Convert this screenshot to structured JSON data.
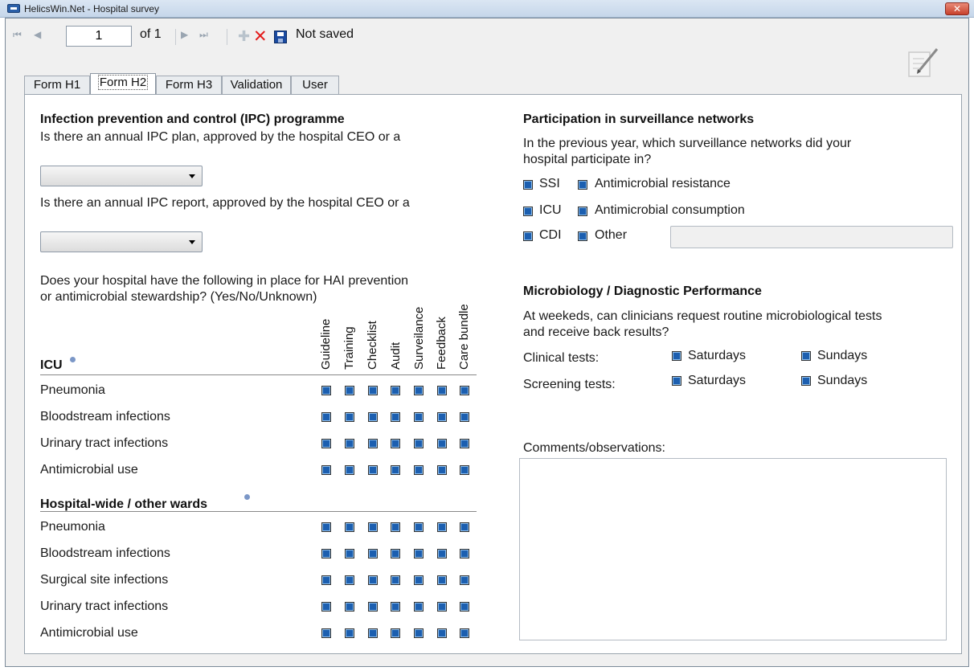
{
  "window": {
    "title": "HelicsWin.Net - Hospital survey",
    "close": "✕"
  },
  "toolbar": {
    "page": "1",
    "of_label": "of 1",
    "status": "Not saved",
    "nav_first": "⏮",
    "nav_prev": "◀",
    "nav_next": "▶",
    "nav_last": "⏭",
    "icons": [
      "nav-first-icon",
      "nav-prev-icon",
      "nav-next-icon",
      "nav-last-icon",
      "add-icon",
      "delete-icon",
      "save-icon",
      "edit-note-icon"
    ]
  },
  "tabs": [
    "Form H1",
    "Form H2",
    "Form H3",
    "Validation",
    "User"
  ],
  "ipc": {
    "heading": "Infection prevention and control (IPC) programme",
    "q1": "Is there an annual IPC plan, approved by the hospital CEO or a",
    "q2": "Is there an annual IPC report, approved by the hospital CEO or a",
    "q3_line1": "Does your hospital have the following in place for HAI prevention",
    "q3_line2": "or antimicrobial stewardship?  (Yes/No/Unknown)"
  },
  "matrix": {
    "columns": [
      "Guideline",
      "Training",
      "Checklist",
      "Audit",
      "Surveilance",
      "Feedback",
      "Care bundle"
    ],
    "icu_heading": "ICU",
    "icu_rows": [
      "Pneumonia",
      "Bloodstream infections",
      "Urinary tract infections",
      "Antimicrobial use"
    ],
    "hospital_heading": "Hospital-wide / other wards",
    "hospital_rows": [
      "Pneumonia",
      "Bloodstream infections",
      "Surgical site infections",
      "Urinary tract infections",
      "Antimicrobial use"
    ]
  },
  "networks": {
    "heading": "Participation in surveillance networks",
    "question_line1": "In the previous year, which surveillance networks did your",
    "question_line2": "hospital participate in?",
    "options": [
      "SSI",
      "Antimicrobial resistance",
      "ICU",
      "Antimicrobial consumption",
      "CDI",
      "Other"
    ]
  },
  "micro": {
    "heading": "Microbiology / Diagnostic Performance",
    "question_line1": "At weekeds, can clinicians request routine microbiological tests",
    "question_line2": "and receive back results?",
    "clinical_label": "Clinical tests:",
    "screening_label": "Screening tests:",
    "saturdays": "Saturdays",
    "sundays": "Sundays"
  },
  "comments": {
    "label": "Comments/observations:"
  },
  "colors": {
    "checkbox": "#1c5fb0",
    "title_bar": "#c5d6ea",
    "close": "#c7412c"
  }
}
